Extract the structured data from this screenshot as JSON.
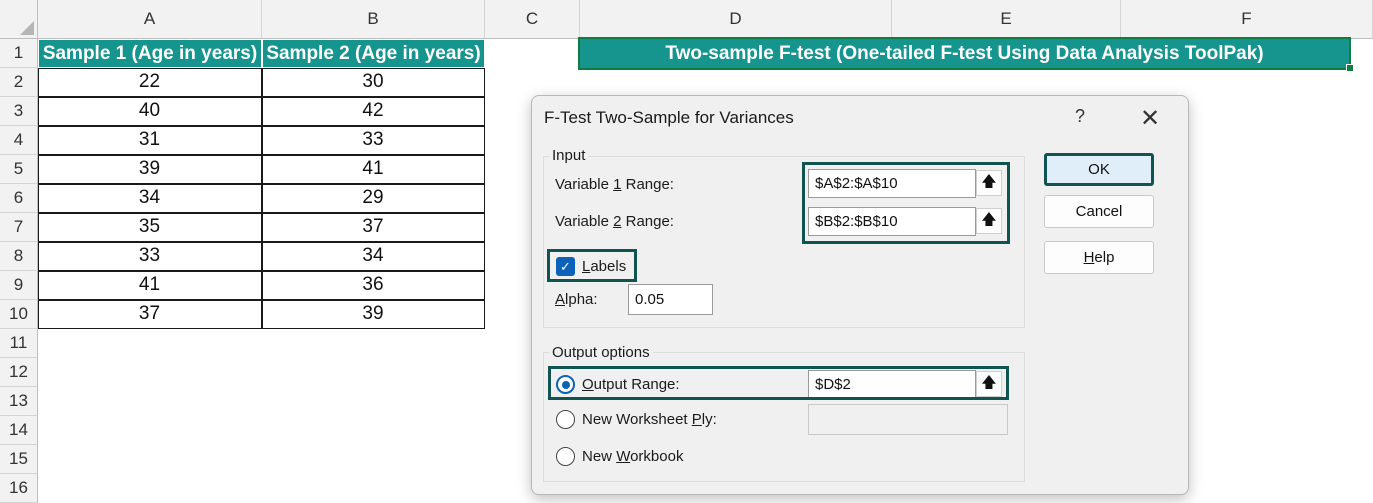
{
  "sheet": {
    "columns": [
      "A",
      "B",
      "C",
      "D",
      "E",
      "F"
    ],
    "rows": [
      "1",
      "2",
      "3",
      "4",
      "5",
      "6",
      "7",
      "8",
      "9",
      "10",
      "11",
      "12",
      "13",
      "14",
      "15",
      "16"
    ],
    "headers": [
      "Sample 1 (Age in years)",
      "Sample 2 (Age in years)"
    ],
    "sample1": [
      "22",
      "40",
      "31",
      "39",
      "34",
      "35",
      "33",
      "41",
      "37"
    ],
    "sample2": [
      "30",
      "42",
      "33",
      "41",
      "29",
      "37",
      "34",
      "36",
      "39"
    ],
    "title_cell": "Two-sample F-test (One-tailed F-test Using Data Analysis ToolPak)",
    "accent_color": "#16958f"
  },
  "dialog": {
    "title": "F-Test Two-Sample for Variances",
    "help_glyph": "?",
    "close_glyph": "✕",
    "input": {
      "group_label": "Input",
      "var1_label_pre": "Variable ",
      "var1_label_key": "1",
      "var1_label_post": " Range:",
      "var1_value": "$A$2:$A$10",
      "var2_label_pre": "Variable ",
      "var2_label_key": "2",
      "var2_label_post": " Range:",
      "var2_value": "$B$2:$B$10",
      "labels_key": "L",
      "labels_rest": "abels",
      "labels_checked": true,
      "alpha_key": "A",
      "alpha_rest": "lpha:",
      "alpha_value": "0.05"
    },
    "output": {
      "group_label": "Output options",
      "range_key": "O",
      "range_rest": "utput Range:",
      "range_value": "$D$2",
      "ply_pre": "New Worksheet ",
      "ply_key": "P",
      "ply_post": "ly:",
      "ply_value": "",
      "wb_pre": "New ",
      "wb_key": "W",
      "wb_post": "orkbook",
      "selected": "Output Range"
    },
    "buttons": {
      "ok": "OK",
      "cancel": "Cancel",
      "help_key": "H",
      "help_rest": "elp"
    },
    "ref_icon": "collapse-dialog-icon"
  }
}
